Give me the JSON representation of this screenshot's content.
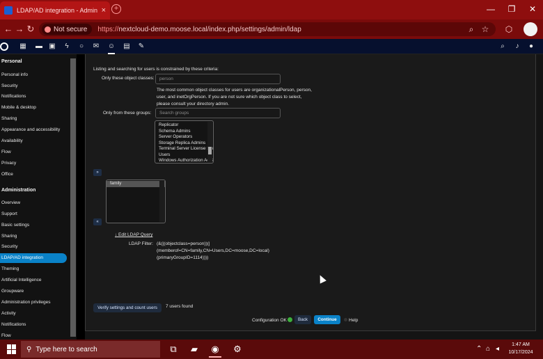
{
  "browser": {
    "tab_title": "LDAP/AD integration - Admin",
    "tab_close": "×",
    "new_tab": "+",
    "not_secure": "Not secure",
    "url_scheme": "https://",
    "url_rest": "nextcloud-demo.moose.local/index.php/settings/admin/ldap",
    "controls": {
      "minimize": "—",
      "restore": "❐",
      "close": "✕"
    }
  },
  "sidebar": {
    "personal_title": "Personal",
    "personal": [
      "Personal info",
      "Security",
      "Notifications",
      "Mobile & desktop",
      "Sharing",
      "Appearance and accessibility",
      "Availability",
      "Flow",
      "Privacy",
      "Office"
    ],
    "admin_title": "Administration",
    "admin": [
      "Overview",
      "Support",
      "Basic settings",
      "Sharing",
      "Security",
      "LDAP/AD integration",
      "Theming",
      "Artificial Intelligence",
      "Groupware",
      "Administration privileges",
      "Activity",
      "Notifications",
      "Flow"
    ]
  },
  "form": {
    "intro": "Listing and searching for users is constrained by these criteria:",
    "object_classes_label": "Only these object classes:",
    "object_classes_value": "person",
    "hint_line1": "The most common object classes for users are organizationalPerson, person,",
    "hint_line2": "user, and inetOrgPerson. If you are not sure which object class to select,",
    "hint_line3": "please consult your directory admin.",
    "groups_label": "Only from these groups:",
    "groups_placeholder": "Search groups",
    "available_groups": [
      "Replicator",
      "Schema Admins",
      "Server Operators",
      "Storage Replica Admins",
      "Terminal Server License Servers",
      "Users",
      "Windows Authorization Access Group"
    ],
    "add_arrow": "»",
    "remove_arrow": "«",
    "selected_groups": [
      "family"
    ],
    "edit_query_link": "↓ Edit LDAP Query",
    "ldap_filter_label": "LDAP Filter:",
    "ldap_filter_line1": "(&(|(objectclass=person))(|",
    "ldap_filter_line2": "(memberof=CN=family,CN=Users,DC=moose,DC=local)",
    "ldap_filter_line3": "(primaryGroupID=1114))))",
    "verify_button": "Verify settings and count users",
    "users_found": "7 users found",
    "config_ok": "Configuration OK",
    "back_button": "Back",
    "continue_button": "Continue",
    "help_link": "Help"
  },
  "taskbar": {
    "search_placeholder": "Type here to search",
    "time": "1:47 AM",
    "date": "10/17/2024"
  }
}
